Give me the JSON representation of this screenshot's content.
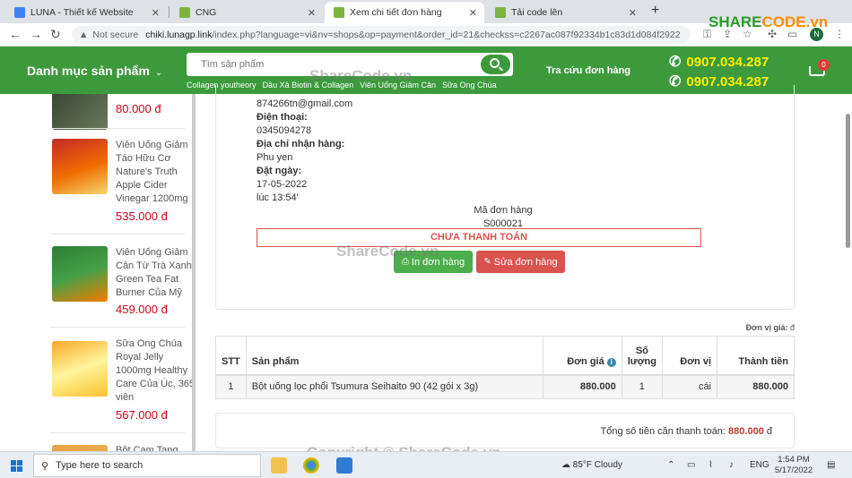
{
  "browser": {
    "tabs": [
      {
        "title": "LUNA - Thiết kế Website",
        "favicon_color": "#3b82f6"
      },
      {
        "title": "CNG",
        "favicon_color": "#7cb342"
      },
      {
        "title": "Xem chi tiết đơn hàng",
        "favicon_color": "#7cb342"
      },
      {
        "title": "Tải code lên",
        "favicon_color": "#7cb342"
      }
    ],
    "security_label": "Not secure",
    "url_host": "chiki.lunagp.link",
    "url_path": "/index.php?language=vi&nv=shops&op=payment&order_id=21&checkss=c2267ac087f92334b1c83d1d084f2922",
    "profile_initial": "N"
  },
  "watermark": {
    "logo_part1": "SHARE",
    "logo_part2": "CODE.vn",
    "text": "ShareCode.vn",
    "copyright": "Copyright © ShareCode.vn"
  },
  "header": {
    "category_menu": "Danh mục sản phẩm",
    "search_placeholder": "Tìm sản phẩm",
    "quick_links": [
      "Collagen youtheory",
      "Dầu Xả Biotin & Collagen",
      "Viên Uống Giảm Cân",
      "Sữa Ong Chúa"
    ],
    "order_lookup": "Tra cứu đơn hàng",
    "hotline_1": "0907.034.287",
    "hotline_2": "0907.034.287",
    "cart_count": "0"
  },
  "sidebar": {
    "currency_symbol": "đ",
    "products": [
      {
        "name": "",
        "price": "80.000 đ"
      },
      {
        "name": "Viên Uống Giảm Táo Hữu Cơ Nature's Truth Apple Cider Vinegar 1200mg",
        "price": "535.000 đ"
      },
      {
        "name": "Viên Uống Giảm Cân Từ Trà Xanh Green Tea Fat Burner Của Mỹ",
        "price": "459.000 đ"
      },
      {
        "name": "Sữa Ong Chúa Royal Jelly 1000mg Healthy Care Của Úc, 365 viên",
        "price": "567.000 đ"
      },
      {
        "name": "Bột Cam Tang",
        "price": ""
      }
    ]
  },
  "order": {
    "email": "874266tn@gmail.com",
    "phone_label": "Điện thoại:",
    "phone": "0345094278",
    "address_label": "Địa chỉ nhận hàng:",
    "address": "Phu yen",
    "date_label": "Đặt ngày:",
    "date": "17-05-2022",
    "time": "lúc 13:54'",
    "code_label": "Mã đơn hàng",
    "code": "S000021",
    "status": "CHƯA THANH TOÁN",
    "print_button": "In đơn hàng",
    "edit_button": "Sửa đơn hàng",
    "unit_note_label": "Đơn vị giá:",
    "unit_note_value": "đ",
    "table": {
      "headers": {
        "stt": "STT",
        "product": "Sản phẩm",
        "price": "Đơn giá",
        "qty_line1": "Số",
        "qty_line2": "lượng",
        "unit": "Đơn vị",
        "total": "Thành tiền"
      },
      "rows": [
        {
          "stt": "1",
          "product": "Bột uống lọc phổi Tsumura Seihaito 90 (42 gói x 3g)",
          "price": "880.000",
          "qty": "1",
          "unit": "cái",
          "total": "880.000"
        }
      ]
    },
    "grand_total_label": "Tổng số tiền cần thanh toán:",
    "grand_total": "880.000",
    "grand_total_currency": "đ"
  },
  "taskbar": {
    "search_placeholder": "Type here to search",
    "weather": "85°F  Cloudy",
    "language": "ENG",
    "time": "1:54 PM",
    "date": "5/17/2022"
  },
  "colors": {
    "header_green": "#3c9a3c",
    "price_red": "#d0021b",
    "hotline_yellow": "#ffee00",
    "print_green": "#4cae4c",
    "edit_red": "#d9534f"
  }
}
